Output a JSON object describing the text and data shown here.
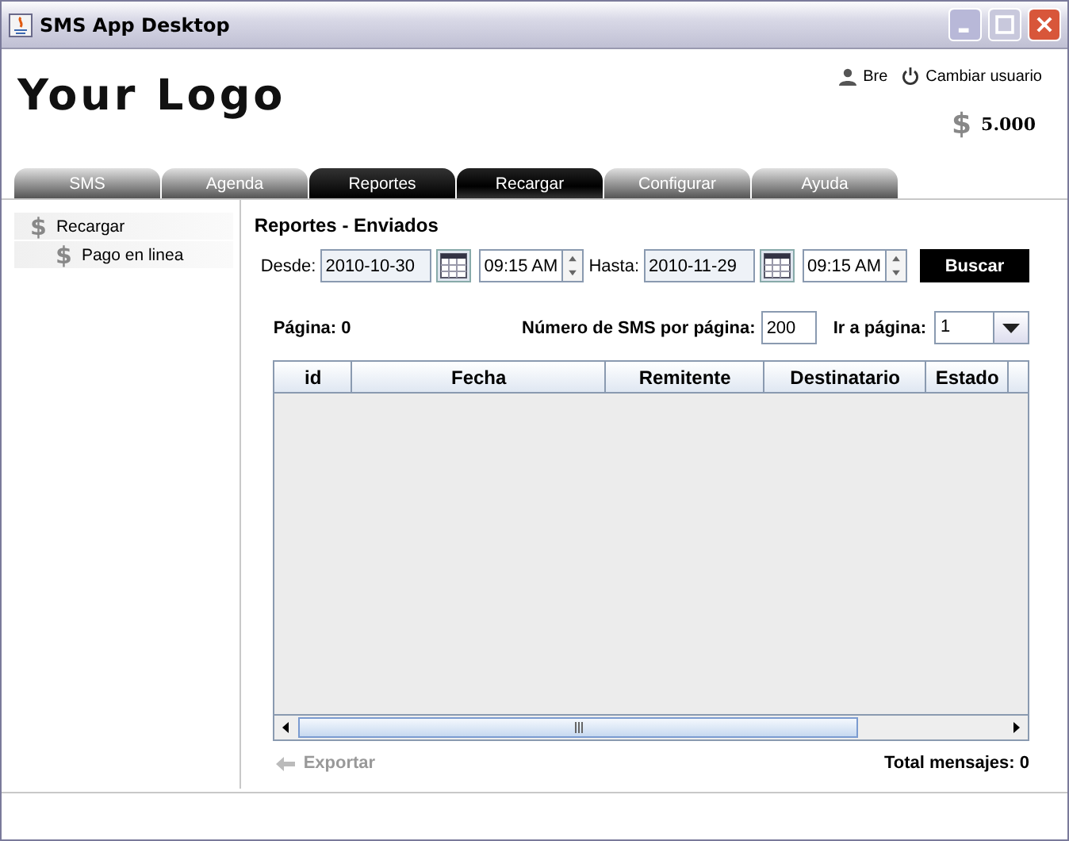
{
  "window": {
    "title": "SMS App Desktop"
  },
  "header": {
    "logo": "Your Logo",
    "user": "Bre",
    "switch_user": "Cambiar usuario",
    "balance_symbol": "$",
    "balance": "5.000"
  },
  "tabs": [
    {
      "label": "SMS",
      "selected": false,
      "highlighted": false
    },
    {
      "label": "Agenda",
      "selected": false,
      "highlighted": false
    },
    {
      "label": "Reportes",
      "selected": true,
      "highlighted": false
    },
    {
      "label": "Recargar",
      "selected": false,
      "highlighted": true
    },
    {
      "label": "Configurar",
      "selected": false,
      "highlighted": false
    },
    {
      "label": "Ayuda",
      "selected": false,
      "highlighted": false
    }
  ],
  "sidebar": {
    "items": [
      {
        "icon": "$",
        "label": "Recargar",
        "children": [
          {
            "icon": "$",
            "label": "Pago en linea"
          }
        ]
      }
    ]
  },
  "report": {
    "title": "Reportes - Enviados",
    "from_label": "Desde:",
    "from_date": "2010-10-30",
    "from_time": "09:15 AM",
    "to_label": "Hasta:",
    "to_date": "2010-11-29",
    "to_time": "09:15 AM",
    "search_button": "Buscar",
    "page_label": "Página: 0",
    "per_page_label": "Número de SMS por página:",
    "per_page": "200",
    "goto_label": "Ir a página:",
    "goto_page": "1",
    "table": {
      "columns": [
        "id",
        "Fecha",
        "Remitente",
        "Destinatario",
        "Estado"
      ]
    },
    "export": {
      "label": "Exportar",
      "disabled": true
    },
    "total": "Total mensajes: 0"
  }
}
